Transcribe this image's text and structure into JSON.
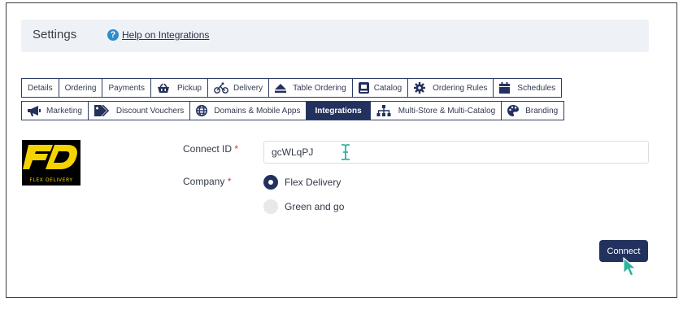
{
  "header": {
    "title": "Settings",
    "help_link": "Help on Integrations"
  },
  "tabs_row1": [
    {
      "label": "Details",
      "icon": "none"
    },
    {
      "label": "Ordering",
      "icon": "none"
    },
    {
      "label": "Payments",
      "icon": "none"
    },
    {
      "label": "Pickup",
      "icon": "basket-icon"
    },
    {
      "label": "Delivery",
      "icon": "bicycle-icon"
    },
    {
      "label": "Table Ordering",
      "icon": "eject-icon"
    },
    {
      "label": "Catalog",
      "icon": "book-icon"
    },
    {
      "label": "Ordering Rules",
      "icon": "gear-icon"
    },
    {
      "label": "Schedules",
      "icon": "calendar-icon"
    }
  ],
  "tabs_row2": [
    {
      "label": "Marketing",
      "icon": "megaphone-icon"
    },
    {
      "label": "Discount Vouchers",
      "icon": "tag-icon"
    },
    {
      "label": "Domains & Mobile Apps",
      "icon": "globe-icon"
    },
    {
      "label": "Integrations",
      "icon": "none",
      "active": true
    },
    {
      "label": "Multi-Store & Multi-Catalog",
      "icon": "sitemap-icon"
    },
    {
      "label": "Branding",
      "icon": "palette-icon"
    }
  ],
  "integration": {
    "logo_text": "FLEX DELIVERY",
    "connect_id_label": "Connect ID",
    "connect_id_value": "gcWLqPJ",
    "company_label": "Company",
    "required_mark": "*",
    "companies": [
      {
        "label": "Flex Delivery",
        "selected": true
      },
      {
        "label": "Green and go",
        "selected": false
      }
    ],
    "connect_button": "Connect"
  },
  "colors": {
    "primary": "#23315e",
    "logo_yellow": "#f5d300",
    "cursor_teal": "#2bb5a0",
    "help_blue": "#2f8ccc"
  }
}
